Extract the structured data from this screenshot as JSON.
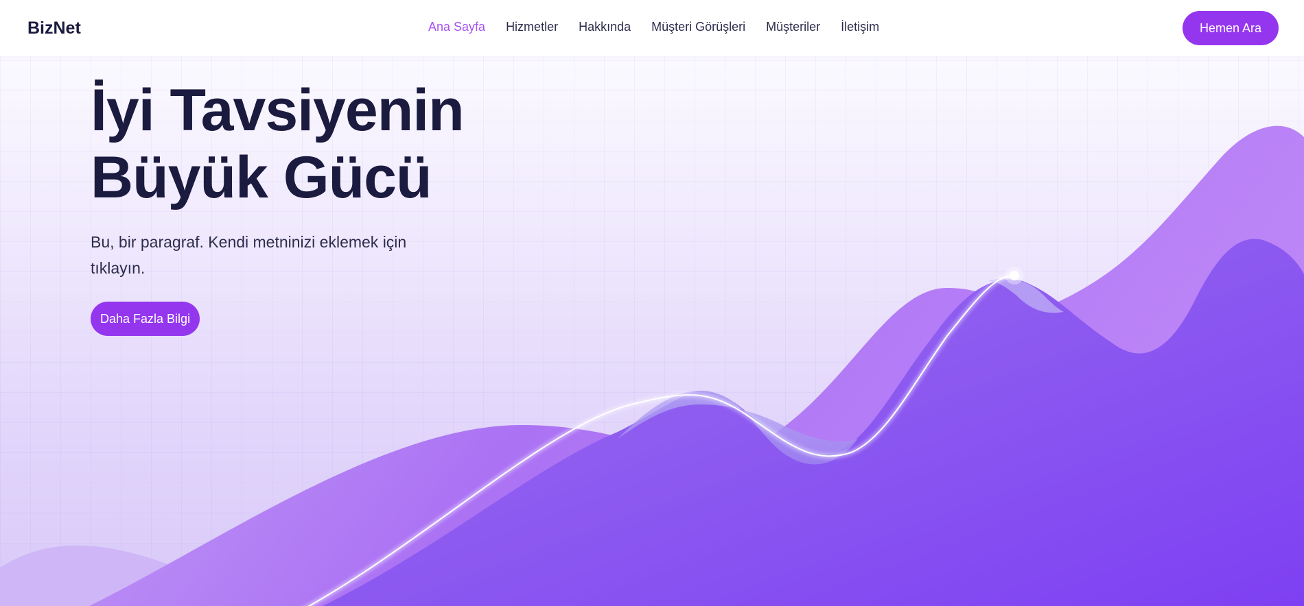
{
  "header": {
    "logo": "BizNet",
    "nav": [
      "Ana Sayfa",
      "Hizmetler",
      "Hakkında",
      "Müşteri Görüşleri",
      "Müşteriler",
      "İletişim"
    ],
    "active_nav": "Ana Sayfa",
    "cta_label": "Hemen Ara"
  },
  "hero": {
    "title_line1": "İyi Tavsiyenin",
    "title_line2": "Büyük Gücü",
    "paragraph": "Bu, bir paragraf. Kendi metninizi eklemek için tıklayın.",
    "button_label": "Daha Fazla Bilgi"
  },
  "colors": {
    "accent": "#9536ef",
    "active_nav": "#a653f2",
    "heading": "#1b1a3f",
    "wave_light": "#b47ef6",
    "wave_deep": "#8044f3"
  },
  "icons": {
    "chart_marker": "peak-marker-icon"
  }
}
